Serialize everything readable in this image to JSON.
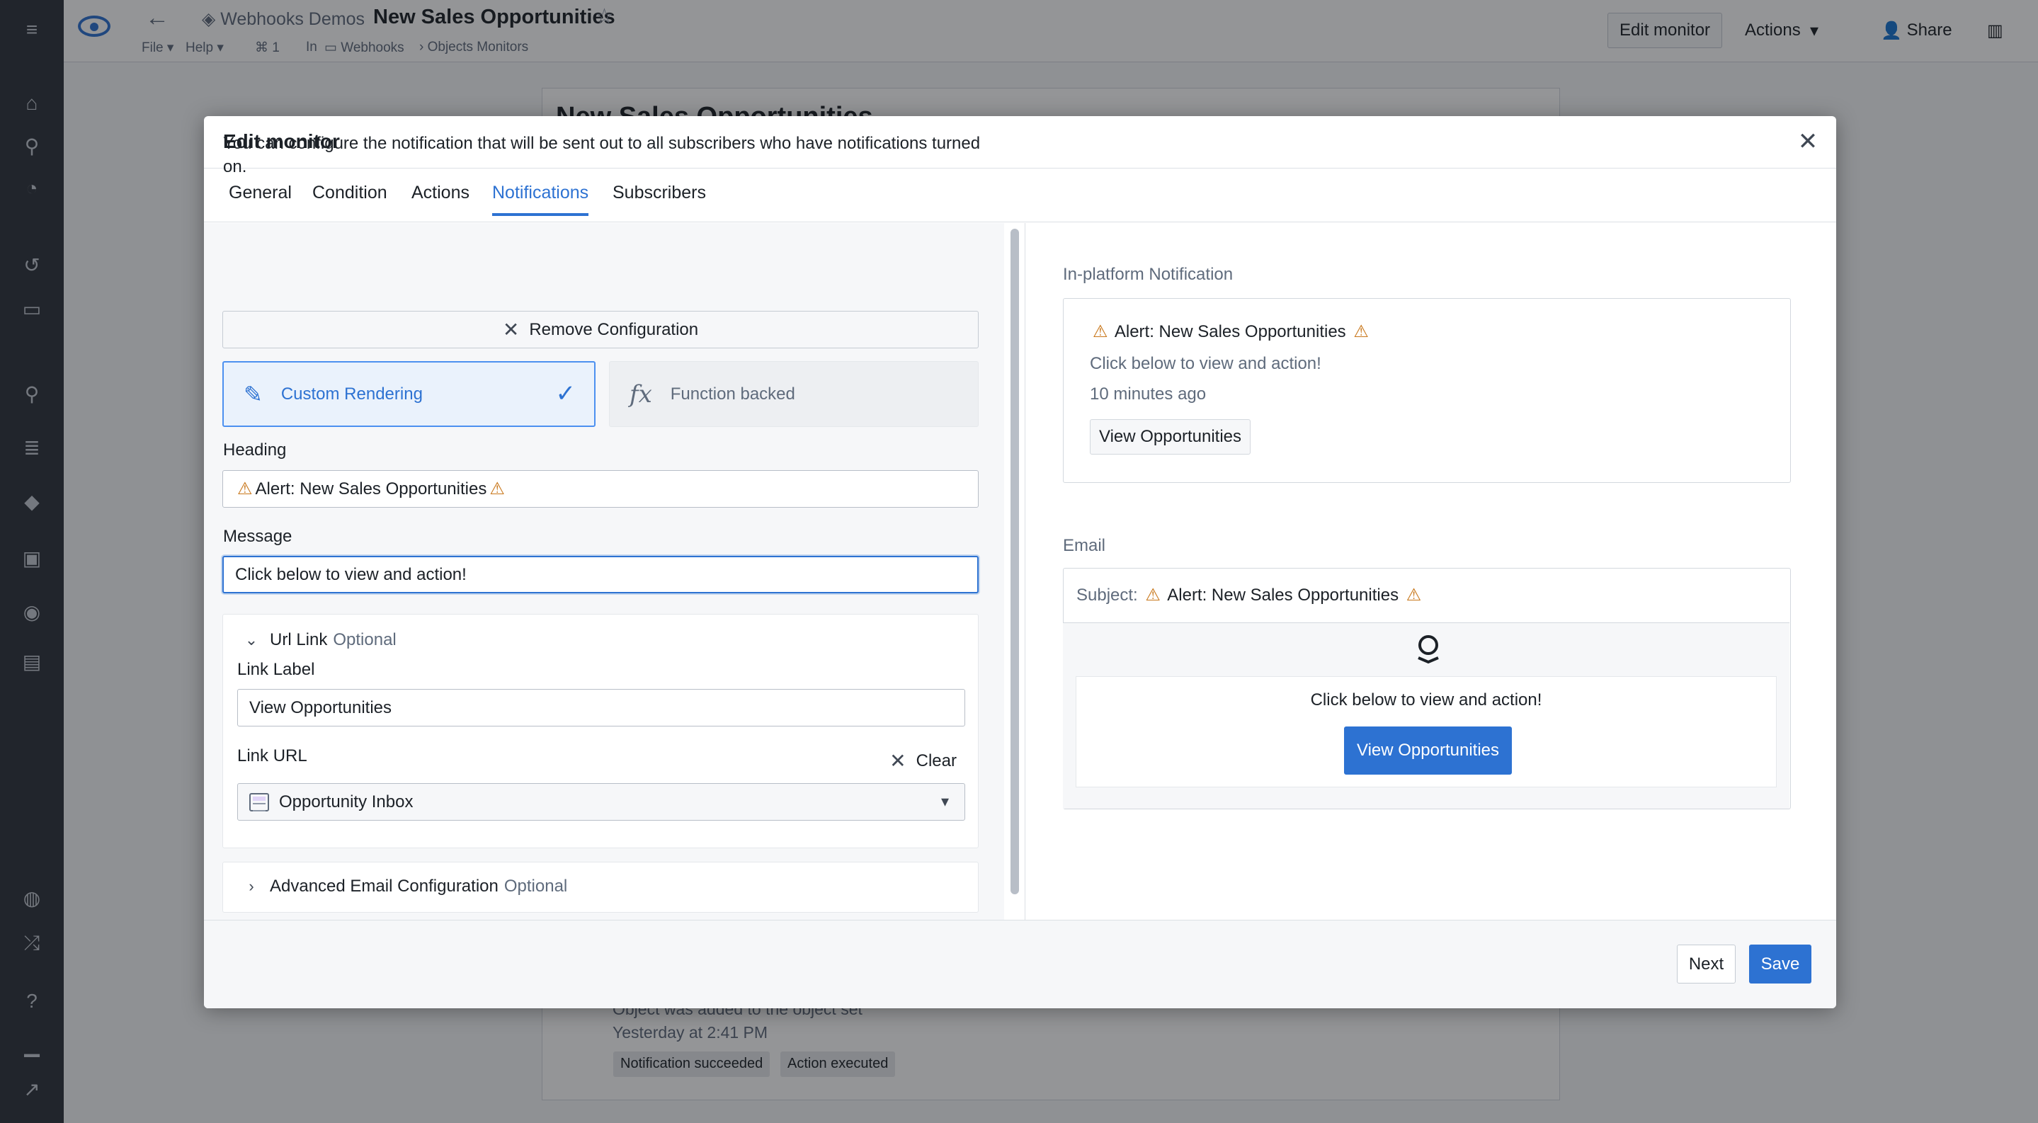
{
  "app": {
    "breadcrumb_root": "Webhooks Demos",
    "page_title": "New Sales Opportunities",
    "menu_file": "File",
    "menu_help": "Help",
    "count": "1",
    "location_prefix": "In",
    "location_folder": "Webhooks",
    "location_sub": "Objects Monitors",
    "edit_monitor_btn": "Edit monitor",
    "actions_btn": "Actions",
    "share_btn": "Share",
    "icons": [
      "menu-icon",
      "eye-logo-icon",
      "back-arrow-icon",
      "cube-icon",
      "star-icon",
      "branch-icon",
      "folder-icon",
      "share-people-icon",
      "sidebar-toggle-icon"
    ]
  },
  "background": {
    "title": "New Sales Opportunities",
    "event_text": "Object was added to the object set",
    "event_time": "Yesterday at 2:41 PM",
    "tags": [
      "Notification succeeded",
      "Action executed"
    ]
  },
  "dialog": {
    "title": "Edit monitor",
    "tabs": [
      {
        "label": "General",
        "active": false
      },
      {
        "label": "Condition",
        "active": false
      },
      {
        "label": "Actions",
        "active": false
      },
      {
        "label": "Notifications",
        "active": true
      },
      {
        "label": "Subscribers",
        "active": false
      }
    ],
    "intro": "You can configure the notification that will be sent out to all subscribers who have notifications turned on.",
    "remove_label": "Remove Configuration",
    "custom_rendering_label": "Custom Rendering",
    "function_backed_label": "Function backed",
    "function_icon_text": "fx",
    "heading_label": "Heading",
    "heading_value": "Alert: New Sales Opportunities",
    "message_label": "Message",
    "message_value": "Click below to view and action!",
    "url_link_title": "Url Link",
    "optional_text": "Optional",
    "link_label_label": "Link Label",
    "link_label_value": "View Opportunities",
    "link_url_label": "Link URL",
    "clear_label": "Clear",
    "link_url_value": "Opportunity Inbox",
    "advanced_title": "Advanced Email Configuration",
    "next_label": "Next",
    "save_label": "Save"
  },
  "preview": {
    "in_platform_label": "In-platform Notification",
    "heading": "Alert: New Sales Opportunities",
    "message": "Click below to view and action!",
    "time_ago": "10 minutes ago",
    "button_label": "View Opportunities",
    "email_label": "Email",
    "subject_key": "Subject:",
    "subject_value": "Alert: New Sales Opportunities",
    "email_message": "Click below to view and action!",
    "email_button_label": "View Opportunities"
  },
  "colors": {
    "accent": "#2d72d2",
    "warning": "#c87619",
    "rail": "#2f343c"
  }
}
